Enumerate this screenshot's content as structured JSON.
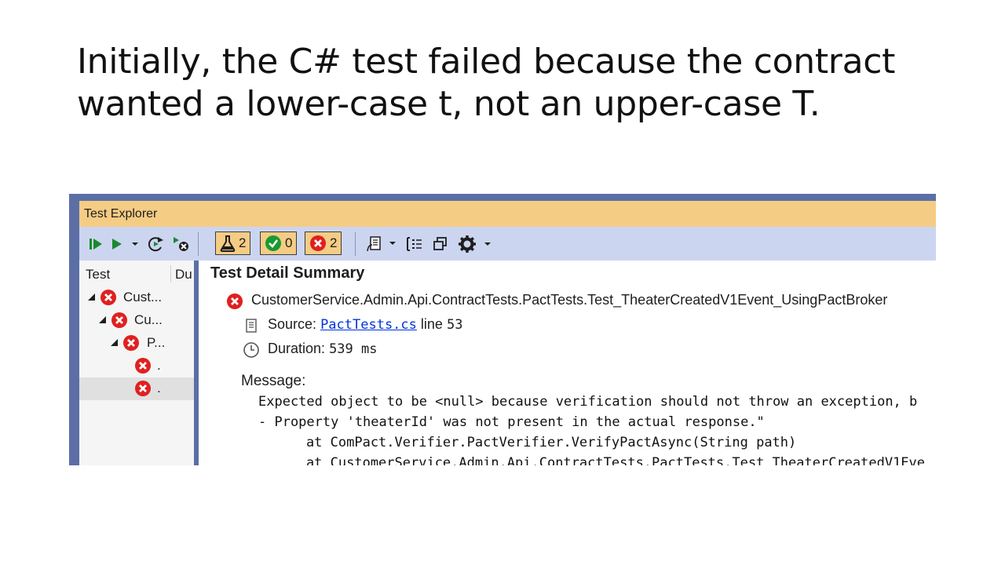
{
  "slide": {
    "title_line1": "Initially, the C# test failed because the contract",
    "title_line2": "wanted a lower-case t, not an upper-case T."
  },
  "window": {
    "title": "Test Explorer"
  },
  "toolbar": {
    "run_all_icon": "run-all-icon",
    "run_icon": "play-icon",
    "repeat_icon": "repeat-run-icon",
    "cancel_icon": "cancel-run-icon",
    "total_count": "2",
    "passed_count": "0",
    "failed_count": "2",
    "playlist_icon": "playlist-icon",
    "group_icon": "group-by-icon",
    "copy_icon": "copy-icon",
    "settings_icon": "gear-icon"
  },
  "tree": {
    "columns": [
      "Test",
      "Du"
    ],
    "rows": [
      {
        "label": "Cust...",
        "status": "failed"
      },
      {
        "label": "Cu...",
        "status": "failed"
      },
      {
        "label": "P...",
        "status": "failed"
      },
      {
        "label": ".",
        "status": "failed"
      },
      {
        "label": ".",
        "status": "failed",
        "selected": true
      }
    ]
  },
  "detail": {
    "heading": "Test Detail Summary",
    "test_name": "CustomerService.Admin.Api.ContractTests.PactTests.Test_TheaterCreatedV1Event_UsingPactBroker",
    "source_label": "Source:",
    "source_file": "PactTests.cs",
    "line_label": "line",
    "line_number": "53",
    "duration_label": "Duration:",
    "duration_value": "539 ms",
    "message_label": "Message:",
    "message_lines": [
      "Expected object to be <null> because verification should not throw an exception, b",
      "- Property 'theaterId' was not present in the actual response.\"",
      "    at ComPact.Verifier.PactVerifier.VerifyPactAsync(String path)",
      "    at CustomerService.Admin.Api.ContractTests.PactTests.Test_TheaterCreatedV1Eve"
    ]
  },
  "colors": {
    "frame": "#5b6fa6",
    "titlebar": "#f5cc84",
    "toolbar": "#ccd5f0",
    "fail": "#e02020",
    "pass": "#1a9a33",
    "link": "#0033dd"
  }
}
